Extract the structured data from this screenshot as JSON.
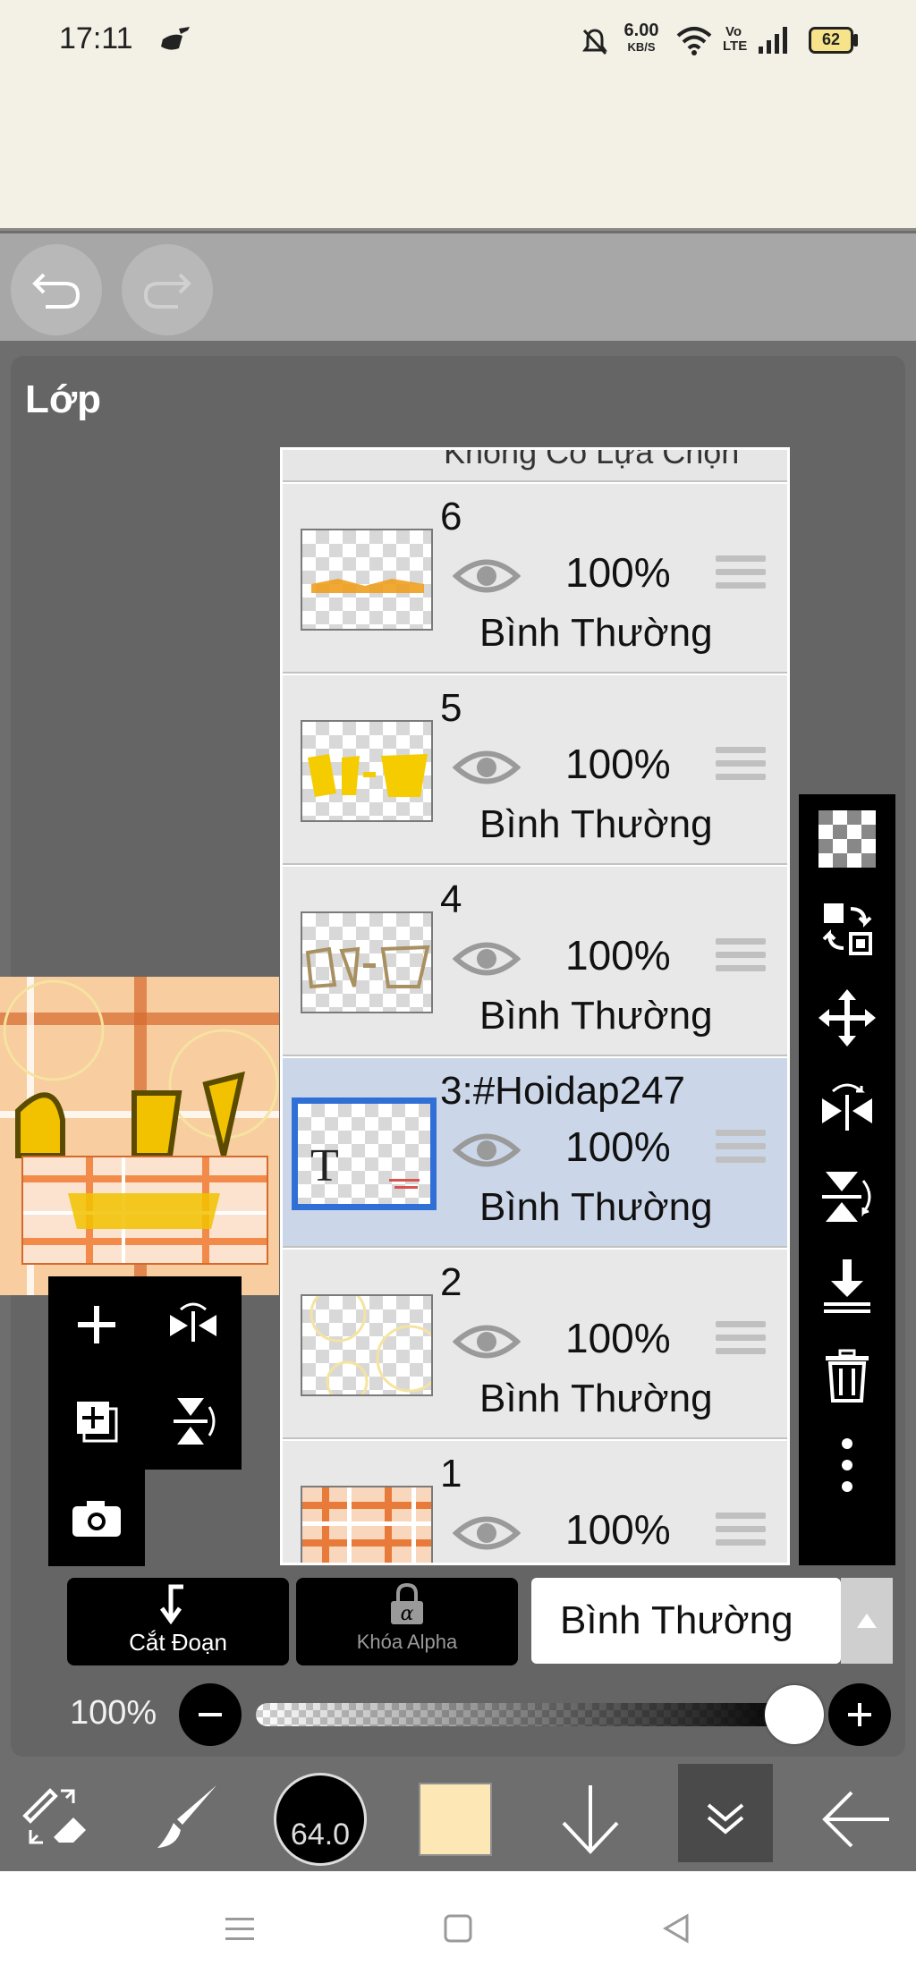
{
  "status_bar": {
    "time": "17:11",
    "net_speed": "6.00",
    "net_speed_unit": "KB/S",
    "volte": "Vo LTE",
    "battery": "62"
  },
  "panel": {
    "title": "Lớp"
  },
  "layer_list": {
    "header_text": "Không Có Lựa Chọn",
    "layers": [
      {
        "number": "6",
        "opacity": "100%",
        "blend": "Bình Thường"
      },
      {
        "number": "5",
        "opacity": "100%",
        "blend": "Bình Thường"
      },
      {
        "number": "4",
        "opacity": "100%",
        "blend": "Bình Thường"
      },
      {
        "number": "3:#Hoidap247",
        "opacity": "100%",
        "blend": "Bình Thường",
        "thumb_text": "T"
      },
      {
        "number": "2",
        "opacity": "100%",
        "blend": "Bình Thường"
      },
      {
        "number": "1",
        "opacity": "100%",
        "blend": ""
      }
    ]
  },
  "bottom_controls": {
    "clip_label": "Cắt Đoạn",
    "alpha_lock_label": "Khóa Alpha",
    "blend_mode": "Bình Thường",
    "opacity_label": "100%",
    "opacity_value": 1.0
  },
  "toolbar": {
    "brush_size": "64.0",
    "color": "#fde7b4"
  },
  "colors": {
    "selected_border": "#2f6fd6",
    "selected_row": "#cbd7e9",
    "panel": "#656565"
  }
}
